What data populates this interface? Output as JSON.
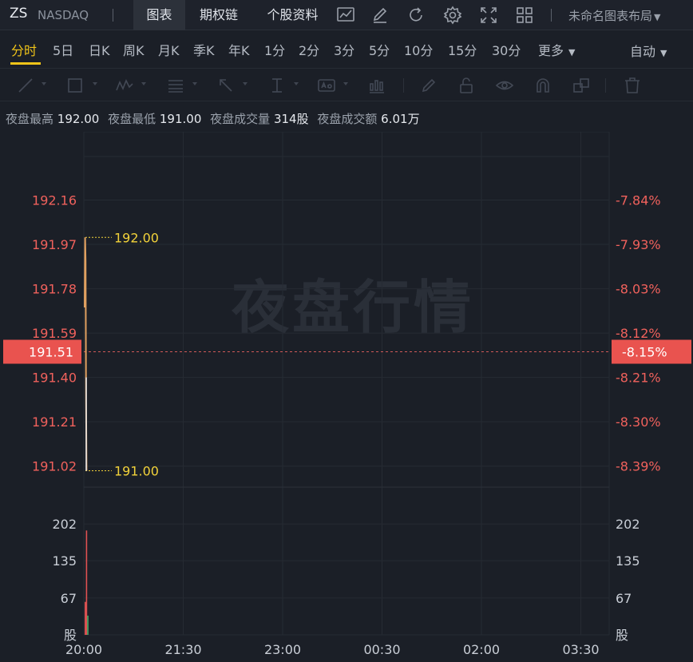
{
  "header": {
    "symbol": "ZS",
    "exchange": "NASDAQ",
    "tabs": [
      "图表",
      "期权链",
      "个股资料"
    ],
    "layout_label": "未命名图表布局",
    "icons": [
      "trend-chart-icon",
      "edit-icon",
      "refresh-icon",
      "settings-icon",
      "fullscreen-icon",
      "grid-layout-icon"
    ]
  },
  "periods": {
    "items": [
      "分时",
      "5日",
      "日K",
      "周K",
      "月K",
      "季K",
      "年K",
      "1分",
      "2分",
      "3分",
      "5分",
      "10分",
      "15分",
      "30分"
    ],
    "active": "分时",
    "more_label": "更多",
    "auto_label": "自动"
  },
  "tools": [
    "line-tool-icon",
    "rect-tool-icon",
    "wave-tool-icon",
    "fib-tool-icon",
    "arrow-tool-icon",
    "measure-tool-icon",
    "text-tool-icon",
    "indicator-tool-icon",
    "brush-tool-icon",
    "lock-icon",
    "eye-icon",
    "magnet-icon",
    "clone-icon",
    "trash-icon"
  ],
  "stats": [
    {
      "label": "夜盘最高",
      "value": "192.00"
    },
    {
      "label": "夜盘最低",
      "value": "191.00"
    },
    {
      "label": "夜盘成交量",
      "value": "314股"
    },
    {
      "label": "夜盘成交额",
      "value": "6.01万"
    }
  ],
  "watermark": "夜盘行情",
  "colors": {
    "price_down": "#f0615c",
    "highlight": "#f2d23a",
    "current_badge": "#e9534f",
    "grid": "#262b33"
  },
  "chart_data": {
    "type": "line",
    "price_axis": {
      "ticks": [
        "192.16",
        "191.97",
        "191.78",
        "191.59",
        "191.40",
        "191.21",
        "191.02"
      ],
      "tick_values": [
        192.16,
        191.97,
        191.78,
        191.59,
        191.4,
        191.21,
        191.02
      ],
      "range": [
        190.93,
        192.35
      ]
    },
    "pct_axis": {
      "ticks": [
        "-7.84%",
        "-7.93%",
        "-8.03%",
        "-8.12%",
        "-8.21%",
        "-8.30%",
        "-8.39%"
      ]
    },
    "current": {
      "price": "191.51",
      "pct": "-8.15%",
      "value": 191.51
    },
    "high_label": {
      "text": "192.00",
      "value": 192.0
    },
    "low_label": {
      "text": "191.00",
      "value": 191.0
    },
    "volume_axis": {
      "ticks": [
        "202",
        "135",
        "67"
      ],
      "tick_values": [
        202,
        135,
        67
      ],
      "unit": "股",
      "range": [
        0,
        269
      ]
    },
    "x_axis": [
      "20:00",
      "21:30",
      "23:00",
      "00:30",
      "02:00",
      "03:30"
    ],
    "price_series": [
      191.7,
      192.0,
      191.9,
      191.3,
      191.0
    ],
    "volume_bars": [
      {
        "value": 60,
        "color": "#e05252"
      },
      {
        "value": 190,
        "color": "#e05252"
      },
      {
        "value": 35,
        "color": "#3fae6a"
      }
    ]
  }
}
